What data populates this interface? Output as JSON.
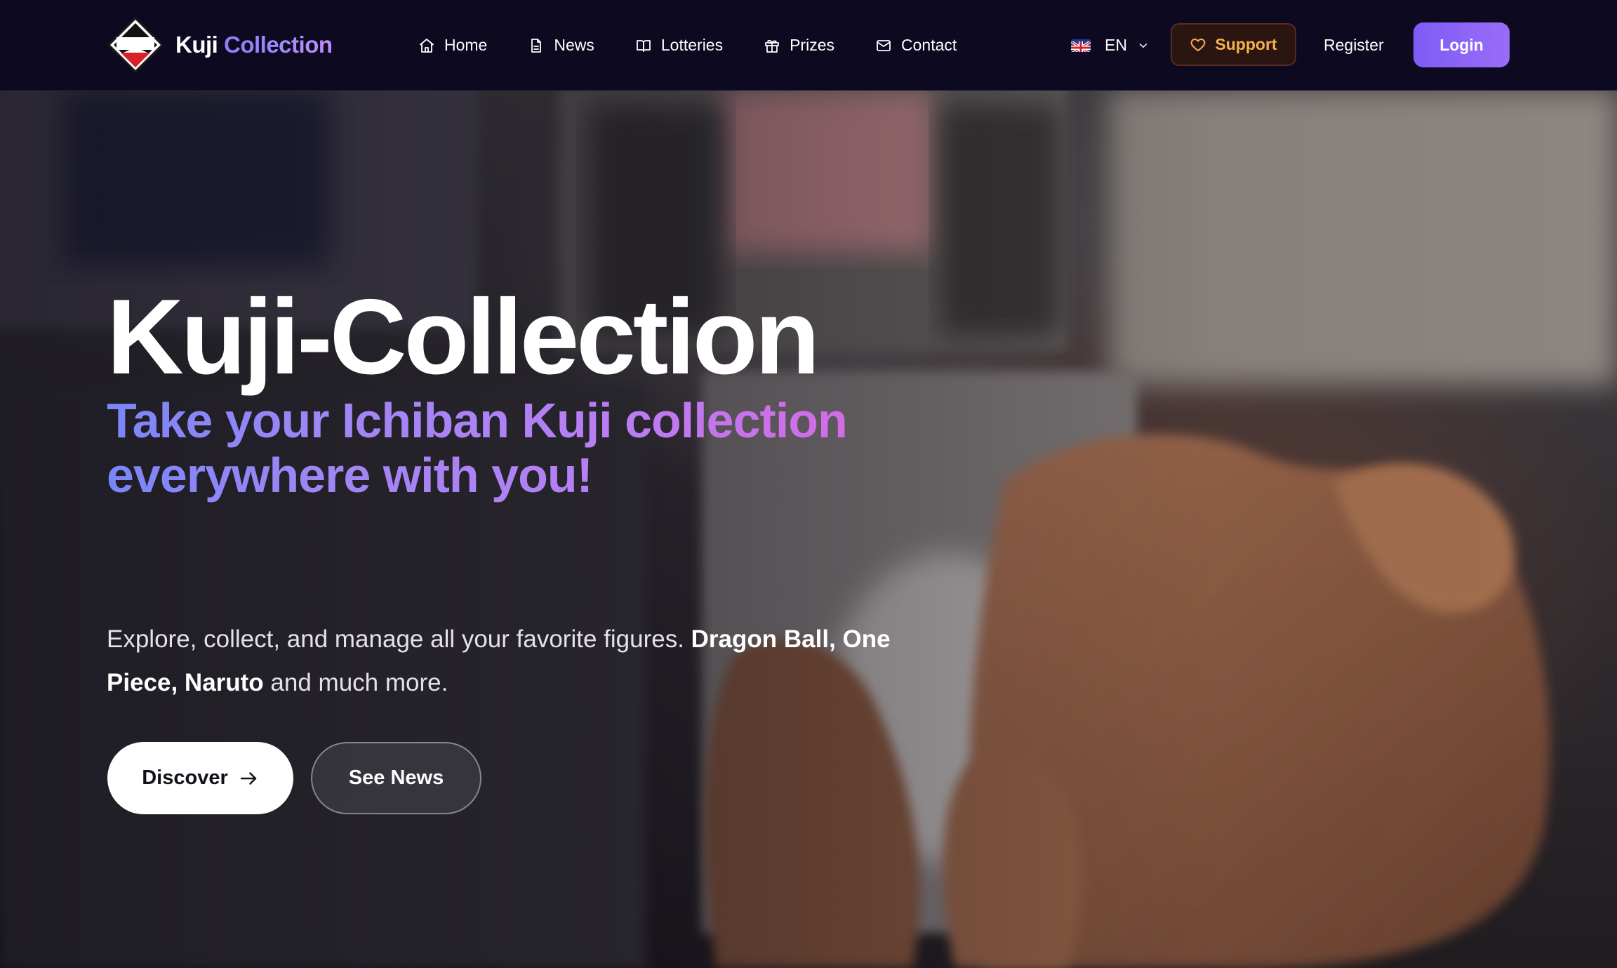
{
  "colors": {
    "nav_bg": "#0c0920",
    "brand_accent": "#a78bfa",
    "support_text": "#f6b34a",
    "login_bg": "#8b64f7",
    "subtitle_gradient": [
      "#7a86f6",
      "#b67ff3",
      "#d36be6"
    ]
  },
  "brand": {
    "logo_icon": "ichiban-kuji-logo",
    "name_primary": "Kuji",
    "name_accent": "Collection"
  },
  "nav": {
    "links": [
      {
        "label": "Home",
        "icon": "home-icon"
      },
      {
        "label": "News",
        "icon": "document-icon"
      },
      {
        "label": "Lotteries",
        "icon": "book-open-icon"
      },
      {
        "label": "Prizes",
        "icon": "gift-icon"
      },
      {
        "label": "Contact",
        "icon": "mail-icon"
      }
    ],
    "language": {
      "code": "EN",
      "flag_icon": "uk-flag-icon"
    },
    "support_label": "Support",
    "register_label": "Register",
    "login_label": "Login"
  },
  "hero": {
    "title": "Kuji-Collection",
    "subtitle": "Take your Ichiban Kuji collection everywhere with you!",
    "description": {
      "part1": "Explore, collect, and manage all your favorite figures. ",
      "bold1": "Dragon Ball, One Piece, Naruto",
      "part2": " and much more."
    },
    "primary_button": "Discover",
    "secondary_button": "See News"
  }
}
